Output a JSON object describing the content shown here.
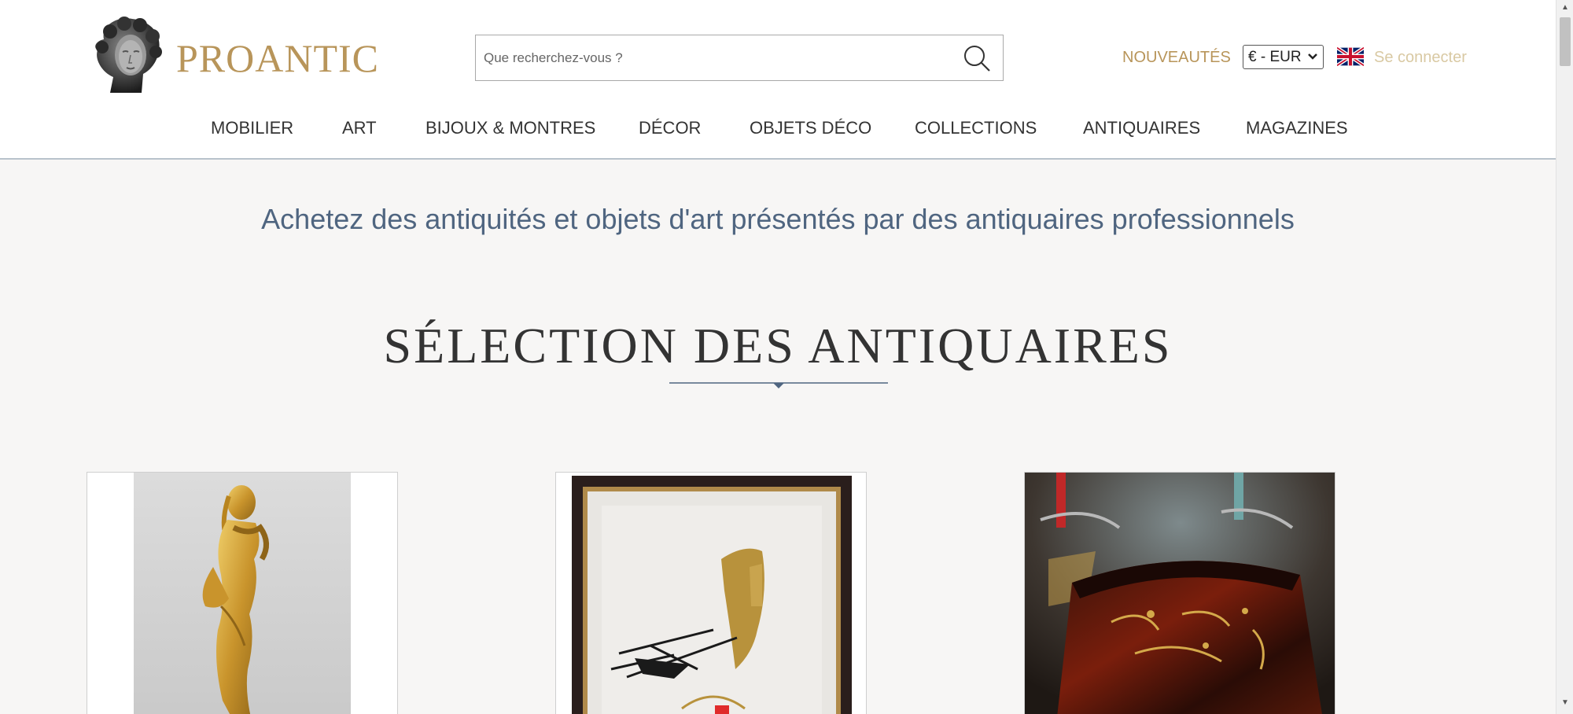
{
  "header": {
    "logo_text": "PROANTIC",
    "search": {
      "placeholder": "Que recherchez-vous ?",
      "value": ""
    },
    "new_label": "NOUVEAUTÉS",
    "currency": "€ - EUR",
    "login_label": "Se connecter"
  },
  "nav": {
    "items": [
      {
        "label": "MOBILIER"
      },
      {
        "label": "ART"
      },
      {
        "label": "BIJOUX & MONTRES"
      },
      {
        "label": "DÉCOR"
      },
      {
        "label": "OBJETS DÉCO"
      },
      {
        "label": "COLLECTIONS"
      },
      {
        "label": "ANTIQUAIRES"
      },
      {
        "label": "MAGAZINES"
      }
    ]
  },
  "main": {
    "tagline": "Achetez des antiquités et objets d'art présentés par des antiquaires professionnels",
    "section_title": "SÉLECTION DES ANTIQUAIRES"
  },
  "colors": {
    "gold": "#b8955a",
    "tagline_blue": "#4f6580",
    "background": "#f7f6f5"
  },
  "icons": [
    "logo-bust-icon",
    "search-icon",
    "uk-flag-icon",
    "chevron-down-icon"
  ]
}
